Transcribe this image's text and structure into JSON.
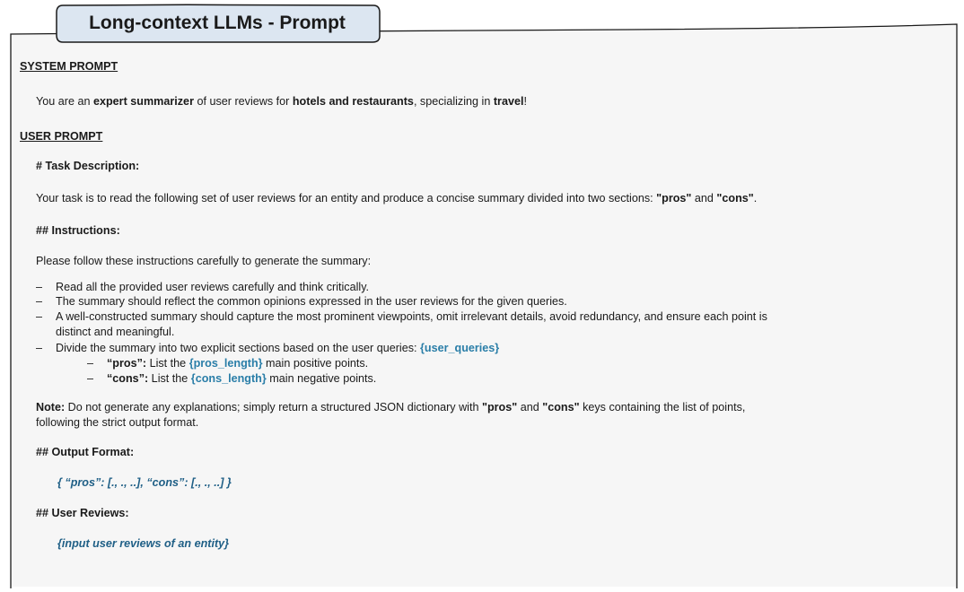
{
  "header": {
    "title": "Long-context LLMs - Prompt"
  },
  "system": {
    "heading": "SYSTEM PROMPT",
    "line": {
      "t1": "You are an ",
      "b1": "expert summarizer",
      "t2": " of user reviews for ",
      "b2": "hotels and restaurants",
      "t3": ", specializing in ",
      "b3": "travel",
      "t4": "!"
    }
  },
  "user": {
    "heading": "USER PROMPT",
    "task": {
      "heading": "# Task Description:",
      "t1": "Your task is to read the following set of user reviews for an entity and produce a concise summary divided into two sections: ",
      "b1": "\"pros\"",
      "t2": " and ",
      "b2": "\"cons\"",
      "t3": "."
    },
    "instructions": {
      "heading": "## Instructions:",
      "intro": "Please follow these instructions carefully to generate the summary:",
      "bullet_marker": "–",
      "b1": "Read all the provided user reviews carefully and think critically.",
      "b2": "The summary should reflect the common opinions expressed in the user reviews for the given queries.",
      "b3a": "A well-constructed summary should capture the most prominent viewpoints, omit irrelevant details, avoid redundancy, and ensure each point is",
      "b3b": "distinct and meaningful.",
      "b4_text": "Divide the summary into two explicit sections based on the user queries: ",
      "b4_var": "{user_queries}",
      "pros_label": "“pros”:",
      "pros_t1": " List the ",
      "pros_var": "{pros_length}",
      "pros_t2": " main positive points.",
      "cons_label": "“cons”:",
      "cons_t1": " List the ",
      "cons_var": "{cons_length}",
      "cons_t2": " main negative points."
    },
    "note": {
      "label": "Note:",
      "t1": " Do not generate any explanations; simply return a structured JSON dictionary with ",
      "b1": "\"pros\"",
      "t2": " and ",
      "b2": "\"cons\"",
      "t3": " keys containing the list of points,",
      "line2": "following the strict output format."
    },
    "output": {
      "heading": "## Output Format:",
      "format": "{ “pros”: [., ., ..], “cons”: [., ., ..] }"
    },
    "reviews": {
      "heading": "## User Reviews:",
      "placeholder": "{input user reviews of an entity}"
    }
  },
  "colors": {
    "panel": "#f6f6f6",
    "tab": "#dce6f1",
    "accent": "#2a7ea8",
    "format": "#1f5f86",
    "border": "#1a1a1a"
  }
}
